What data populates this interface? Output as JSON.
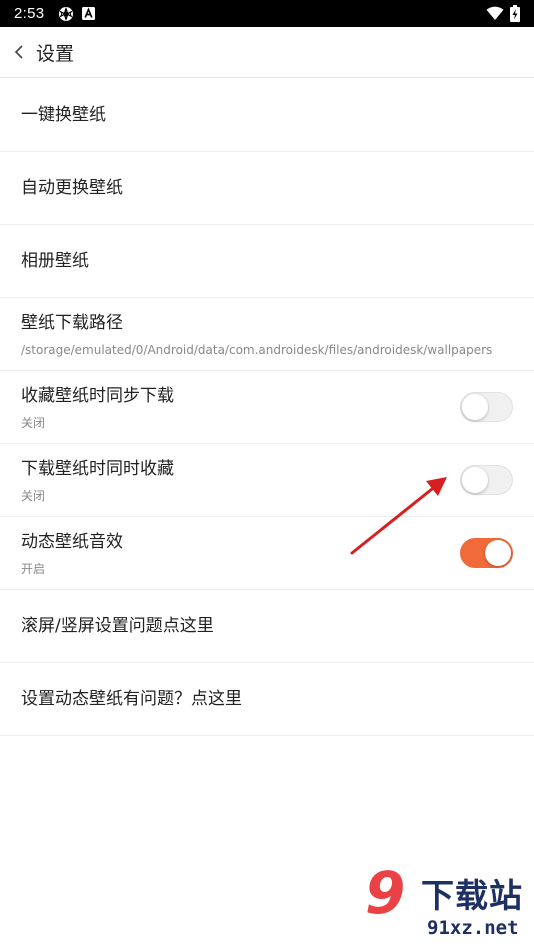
{
  "status_bar": {
    "time": "2:53",
    "icons": [
      "gear-icon",
      "a-badge-icon",
      "wifi-icon",
      "battery-charging-icon"
    ]
  },
  "header": {
    "back_icon": "chevron-left-icon",
    "title": "设置"
  },
  "settings": {
    "items": [
      {
        "title": "一键换壁纸"
      },
      {
        "title": "自动更换壁纸"
      },
      {
        "title": "相册壁纸"
      },
      {
        "title": "壁纸下载路径",
        "subtitle": "/storage/emulated/0/Android/data/com.androidesk/files/androidesk/wallpapers"
      },
      {
        "title": "收藏壁纸时同步下载",
        "subtitle": "关闭",
        "toggle_on": false
      },
      {
        "title": "下载壁纸时同时收藏",
        "subtitle": "关闭",
        "toggle_on": false
      },
      {
        "title": "动态壁纸音效",
        "subtitle": "开启",
        "toggle_on": true
      },
      {
        "title": "滚屏/竖屏设置问题点这里"
      },
      {
        "title": "设置动态壁纸有问题？点这里"
      }
    ]
  },
  "colors": {
    "toggle_on": "#f06a3a",
    "arrow": "#d81f1f",
    "watermark_red": "#e8373a",
    "watermark_navy": "#1d2f63"
  },
  "watermark": {
    "number": "9",
    "brand": "下载站",
    "url": "91xz.net"
  }
}
